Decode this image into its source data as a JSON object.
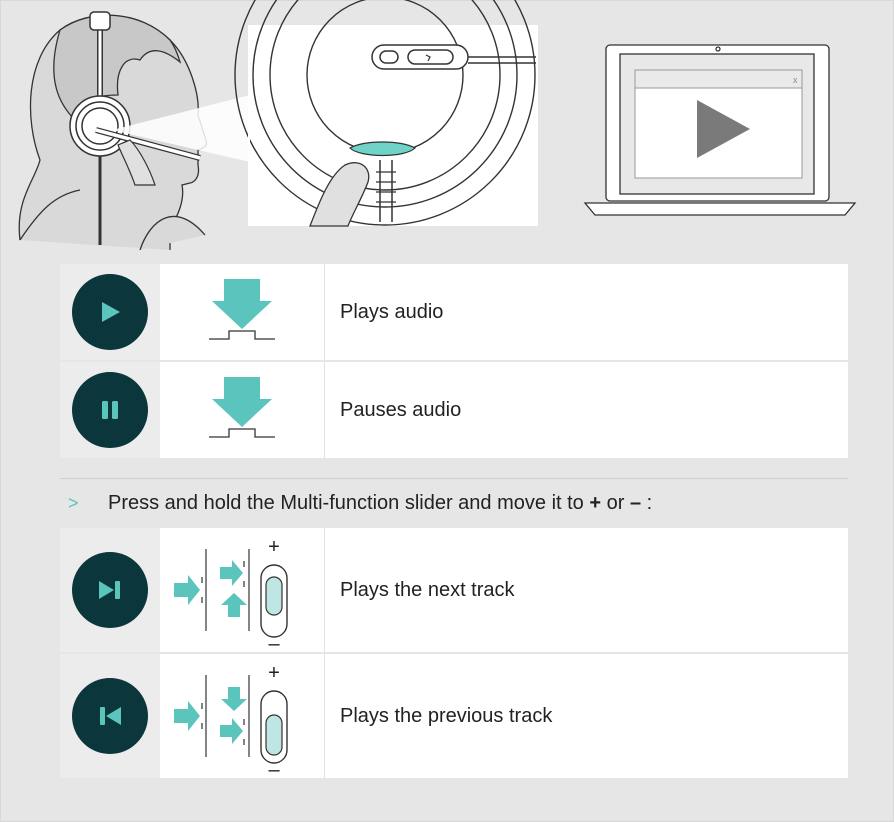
{
  "illustration": {
    "accent": "#6fd3c8",
    "close_mark": "x"
  },
  "rows": [
    {
      "icon": "play-icon",
      "action": "press-down-arrow-icon",
      "label": "Plays audio"
    },
    {
      "icon": "pause-icon",
      "action": "press-down-arrow-icon",
      "label": "Pauses audio"
    },
    {
      "icon": "next-track-icon",
      "action": "slider-plus-icon",
      "label": "Plays the next track"
    },
    {
      "icon": "previous-track-icon",
      "action": "slider-minus-icon",
      "label": "Plays the previous track"
    }
  ],
  "instruction": {
    "bullet": ">",
    "text_before": "Press and hold the Multi-function slider and move it to ",
    "plus": "+",
    "or": " or ",
    "minus": "–",
    "text_after": " :"
  },
  "slider": {
    "plus": "+",
    "minus": "–"
  },
  "colors": {
    "circle": "#0b363b",
    "accent": "#5bc4bd",
    "background": "#e6e6e6"
  }
}
